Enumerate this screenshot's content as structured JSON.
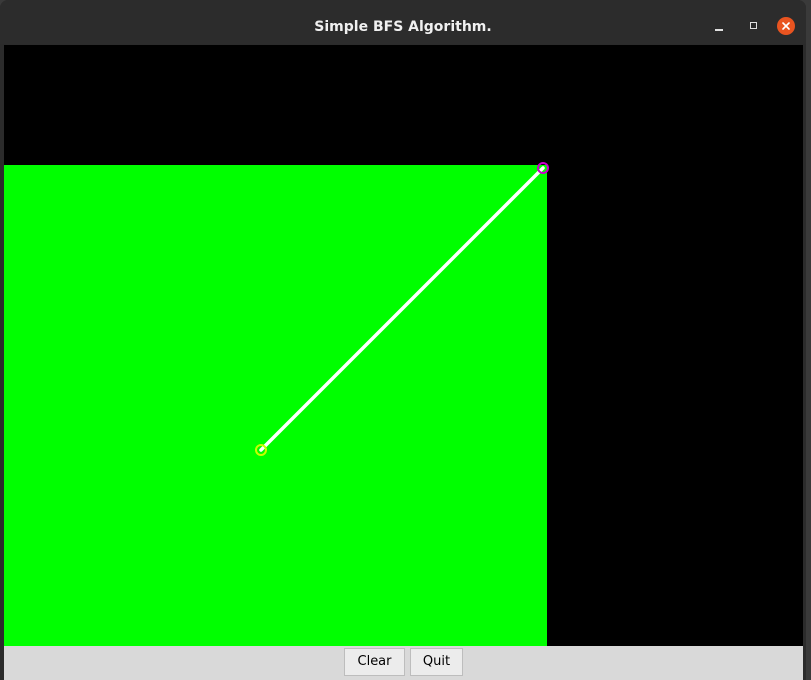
{
  "window": {
    "title": "Simple BFS Algorithm.",
    "controls": [
      "minimize-icon",
      "maximize-icon",
      "close-icon"
    ],
    "close_color": "#e95420"
  },
  "canvas": {
    "background_color": "#000000",
    "region_color": "#00ff00",
    "path_color": "#ffffff",
    "start_marker_color": "#c8ff00",
    "goal_marker_color": "#cc00cc"
  },
  "buttons": {
    "clear_label": "Clear",
    "quit_label": "Quit"
  }
}
